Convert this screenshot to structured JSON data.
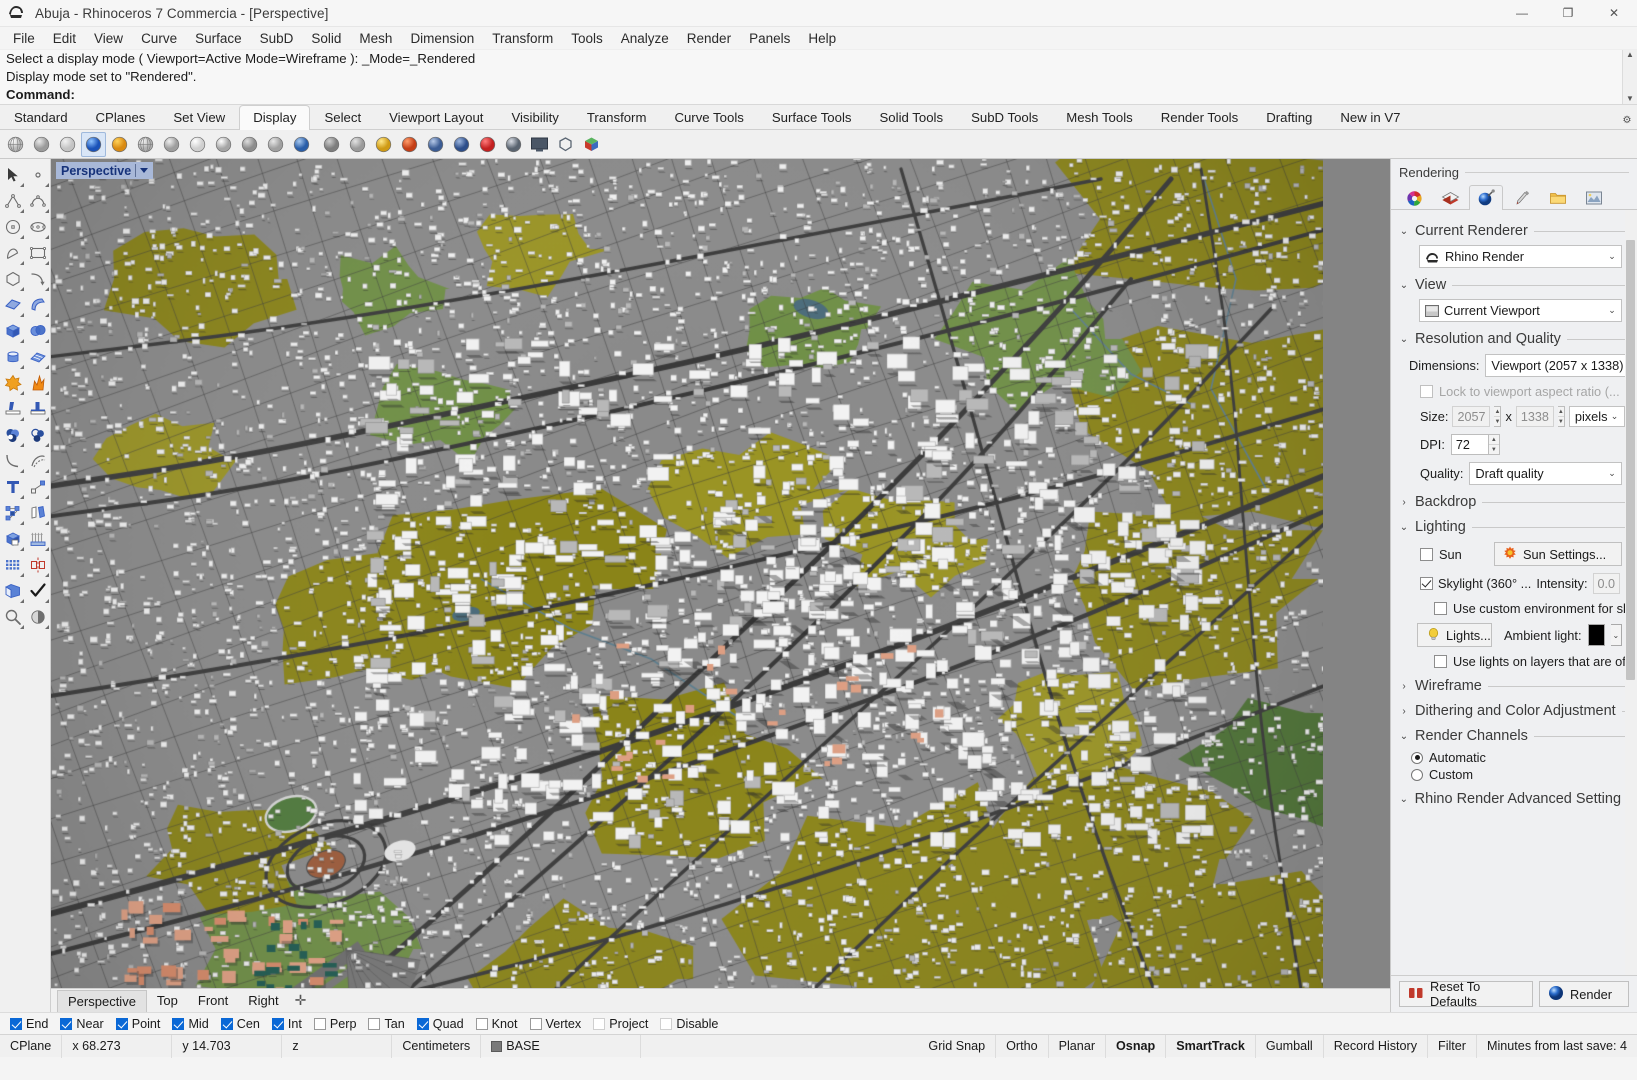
{
  "window": {
    "title": "Abuja - Rhinoceros 7 Commercia - [Perspective]",
    "app_icon": "rhino-logo-icon",
    "minimize": "—",
    "maximize": "❐",
    "close": "✕"
  },
  "menubar": {
    "items": [
      "File",
      "Edit",
      "View",
      "Curve",
      "Surface",
      "SubD",
      "Solid",
      "Mesh",
      "Dimension",
      "Transform",
      "Tools",
      "Analyze",
      "Render",
      "Panels",
      "Help"
    ]
  },
  "command_history": {
    "line1": "Select a display mode ( Viewport=Active  Mode=Wireframe ): _Mode=_Rendered",
    "line2": "Display mode set to \"Rendered\".",
    "prompt": "Command:"
  },
  "toolbar_tabs": {
    "items": [
      "Standard",
      "CPlanes",
      "Set View",
      "Display",
      "Select",
      "Viewport Layout",
      "Visibility",
      "Transform",
      "Curve Tools",
      "Surface Tools",
      "Solid Tools",
      "SubD Tools",
      "Mesh Tools",
      "Render Tools",
      "Drafting",
      "New in V7"
    ],
    "active": "Display"
  },
  "display_toolbar": {
    "icons": [
      {
        "name": "wireframe-icon",
        "selected": false
      },
      {
        "name": "shaded-icon",
        "selected": false
      },
      {
        "name": "ghosted-icon",
        "selected": false
      },
      {
        "name": "rendered-icon",
        "selected": true
      },
      {
        "name": "arctic-icon",
        "selected": false
      },
      {
        "name": "xray-icon",
        "selected": false
      },
      {
        "name": "technical-icon",
        "selected": false
      },
      {
        "name": "artistic-icon",
        "selected": false
      },
      {
        "name": "pen-icon",
        "selected": false
      },
      {
        "name": "raytraced-icon",
        "selected": false
      },
      {
        "name": "monochrome-icon",
        "selected": false
      },
      {
        "name": "display-options-icon",
        "selected": false
      },
      {
        "name": "shade-selected-icon",
        "selected": false
      },
      {
        "name": "flat-shade-icon",
        "selected": false
      },
      {
        "name": "render-preview-icon",
        "selected": false
      },
      {
        "name": "render-in-window-icon",
        "selected": false
      },
      {
        "name": "shadows-icon",
        "selected": false
      },
      {
        "name": "curvature-graph-icon",
        "selected": false
      },
      {
        "name": "zebra-icon",
        "selected": false
      },
      {
        "name": "hide-curves-icon",
        "selected": false
      },
      {
        "name": "fullscreen-icon",
        "selected": false
      },
      {
        "name": "bounding-box-icon",
        "selected": false
      },
      {
        "name": "color-mode-icon",
        "selected": false
      }
    ]
  },
  "left_toolbar": {
    "icons": [
      "select-arrow-icon",
      "point-icon",
      "polyline-icon",
      "curve-icon",
      "circle-icon",
      "ellipse-icon",
      "arc-icon",
      "rectangle-icon",
      "polygon-icon",
      "curve-tools-icon",
      "surface-plane-icon",
      "surface-loft-icon",
      "box-icon",
      "sphere-boolean-icon",
      "cylinder-icon",
      "surface-edit-icon",
      "explode-icon",
      "blast-flame-icon",
      "split-icon",
      "trim-icon",
      "boolean-union-icon",
      "boolean-difference-icon",
      "fillet-icon",
      "blend-icon",
      "text-icon",
      "dimension-icon",
      "group-icon",
      "copy-icon",
      "solid-tools-icon",
      "extrude-icon",
      "array-icon",
      "mirror-icon",
      "layers-icon",
      "check-icon",
      "analyze-icon",
      "appearance-icon"
    ]
  },
  "viewport": {
    "label": "Perspective",
    "dropdown_icon": "chevron-down-icon",
    "scene": "aerial-city-3d-model"
  },
  "view_tabs": {
    "items": [
      "Perspective",
      "Top",
      "Front",
      "Right"
    ],
    "active": "Perspective",
    "add_icon": "add-viewport-icon"
  },
  "render_panel": {
    "title": "Rendering",
    "tabs": [
      {
        "name": "materials-tab",
        "icon": "color-wheel-icon",
        "active": false
      },
      {
        "name": "layers-tab",
        "icon": "layers-stack-icon",
        "active": false
      },
      {
        "name": "rendering-tab",
        "icon": "render-sphere-icon",
        "active": true
      },
      {
        "name": "display-tab",
        "icon": "paintbrush-icon",
        "active": false
      },
      {
        "name": "explorer-tab",
        "icon": "folder-icon",
        "active": false
      },
      {
        "name": "render-window-tab",
        "icon": "picture-frame-icon",
        "active": false
      }
    ],
    "sections": {
      "current_renderer": {
        "label": "Current Renderer",
        "expanded": true,
        "value": "Rhino Render",
        "icon": "rhino-head-icon"
      },
      "view": {
        "label": "View",
        "expanded": true,
        "value": "Current Viewport",
        "icon": "viewport-icon"
      },
      "resolution_and_quality": {
        "label": "Resolution and Quality",
        "expanded": true,
        "dimensions_label": "Dimensions:",
        "dimensions_value": "Viewport (2057 x 1338)",
        "lock_aspect_label": "Lock to viewport aspect ratio (...",
        "lock_aspect_checked": false,
        "lock_aspect_disabled": true,
        "size_label": "Size:",
        "size_width": "2057",
        "size_x": "x",
        "size_height": "1338",
        "size_units": "pixels",
        "dpi_label": "DPI:",
        "dpi_value": "72",
        "quality_label": "Quality:",
        "quality_value": "Draft quality"
      },
      "backdrop": {
        "label": "Backdrop",
        "expanded": false
      },
      "lighting": {
        "label": "Lighting",
        "expanded": true,
        "sun_label": "Sun",
        "sun_checked": false,
        "sun_settings_button": "Sun Settings...",
        "sun_icon": "sun-icon",
        "skylight_label": "Skylight (360° ...",
        "skylight_checked": true,
        "intensity_label": "Intensity:",
        "intensity_value": "0.0",
        "custom_env_label": "Use custom environment for sk...",
        "custom_env_checked": false,
        "lights_button": "Lights...",
        "lights_icon": "lightbulb-icon",
        "ambient_label": "Ambient light:",
        "ambient_color": "#000000",
        "layer_lights_label": "Use lights on layers that are off",
        "layer_lights_checked": false
      },
      "wireframe": {
        "label": "Wireframe",
        "expanded": false
      },
      "dithering": {
        "label": "Dithering and Color Adjustment",
        "expanded": false
      },
      "render_channels": {
        "label": "Render Channels",
        "expanded": true,
        "options": [
          "Automatic",
          "Custom"
        ],
        "selected": "Automatic"
      },
      "advanced": {
        "label": "Rhino Render Advanced Settings",
        "expanded": true
      }
    },
    "footer": {
      "reset_button": "Reset To Defaults",
      "reset_icon": "reset-icon",
      "render_button": "Render",
      "render_icon": "render-sphere-icon"
    }
  },
  "osnap_bar": {
    "items": [
      {
        "label": "End",
        "checked": true
      },
      {
        "label": "Near",
        "checked": true
      },
      {
        "label": "Point",
        "checked": true
      },
      {
        "label": "Mid",
        "checked": true
      },
      {
        "label": "Cen",
        "checked": true
      },
      {
        "label": "Int",
        "checked": true
      },
      {
        "label": "Perp",
        "checked": false
      },
      {
        "label": "Tan",
        "checked": false
      },
      {
        "label": "Quad",
        "checked": true
      },
      {
        "label": "Knot",
        "checked": false
      },
      {
        "label": "Vertex",
        "checked": false
      },
      {
        "label": "Project",
        "checked": false,
        "dim": true
      },
      {
        "label": "Disable",
        "checked": false,
        "dim": true
      }
    ]
  },
  "status_bar": {
    "cplane": "CPlane",
    "x": "x 68.273",
    "y": "y 14.703",
    "z": "z",
    "units": "Centimeters",
    "layer": "BASE",
    "layer_color": "#7a7a7a",
    "toggles": [
      {
        "label": "Grid Snap",
        "on": false
      },
      {
        "label": "Ortho",
        "on": false
      },
      {
        "label": "Planar",
        "on": false
      },
      {
        "label": "Osnap",
        "on": true
      },
      {
        "label": "SmartTrack",
        "on": true
      },
      {
        "label": "Gumball",
        "on": false
      },
      {
        "label": "Record History",
        "on": false
      },
      {
        "label": "Filter",
        "on": false
      }
    ],
    "save_info": "Minutes from last save: 4"
  }
}
